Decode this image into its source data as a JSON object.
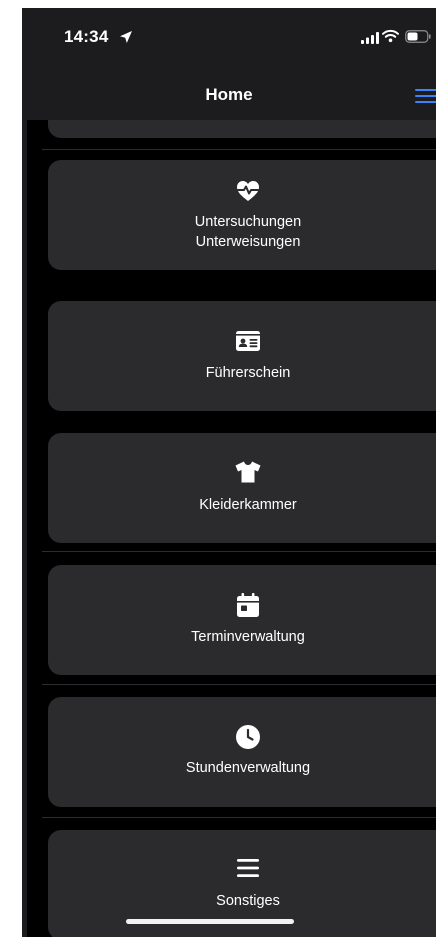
{
  "status_bar": {
    "time": "14:34"
  },
  "navbar": {
    "title": "Home"
  },
  "menu": {
    "items": [
      {
        "label_lines": [
          "Untersuchungen",
          "Unterweisungen"
        ],
        "icon": "heart-pulse-icon"
      },
      {
        "label_lines": [
          "Führerschein"
        ],
        "icon": "id-card-icon"
      },
      {
        "label_lines": [
          "Kleiderkammer"
        ],
        "icon": "tshirt-icon"
      },
      {
        "label_lines": [
          "Terminverwaltung"
        ],
        "icon": "calendar-icon"
      },
      {
        "label_lines": [
          "Stundenverwaltung"
        ],
        "icon": "clock-icon"
      },
      {
        "label_lines": [
          "Sonstiges"
        ],
        "icon": "bars-icon"
      }
    ]
  },
  "colors": {
    "background": "#000000",
    "card": "#2b2b2d",
    "bar": "#1c1c1e",
    "accent": "#3b82f6",
    "text": "#ffffff"
  }
}
